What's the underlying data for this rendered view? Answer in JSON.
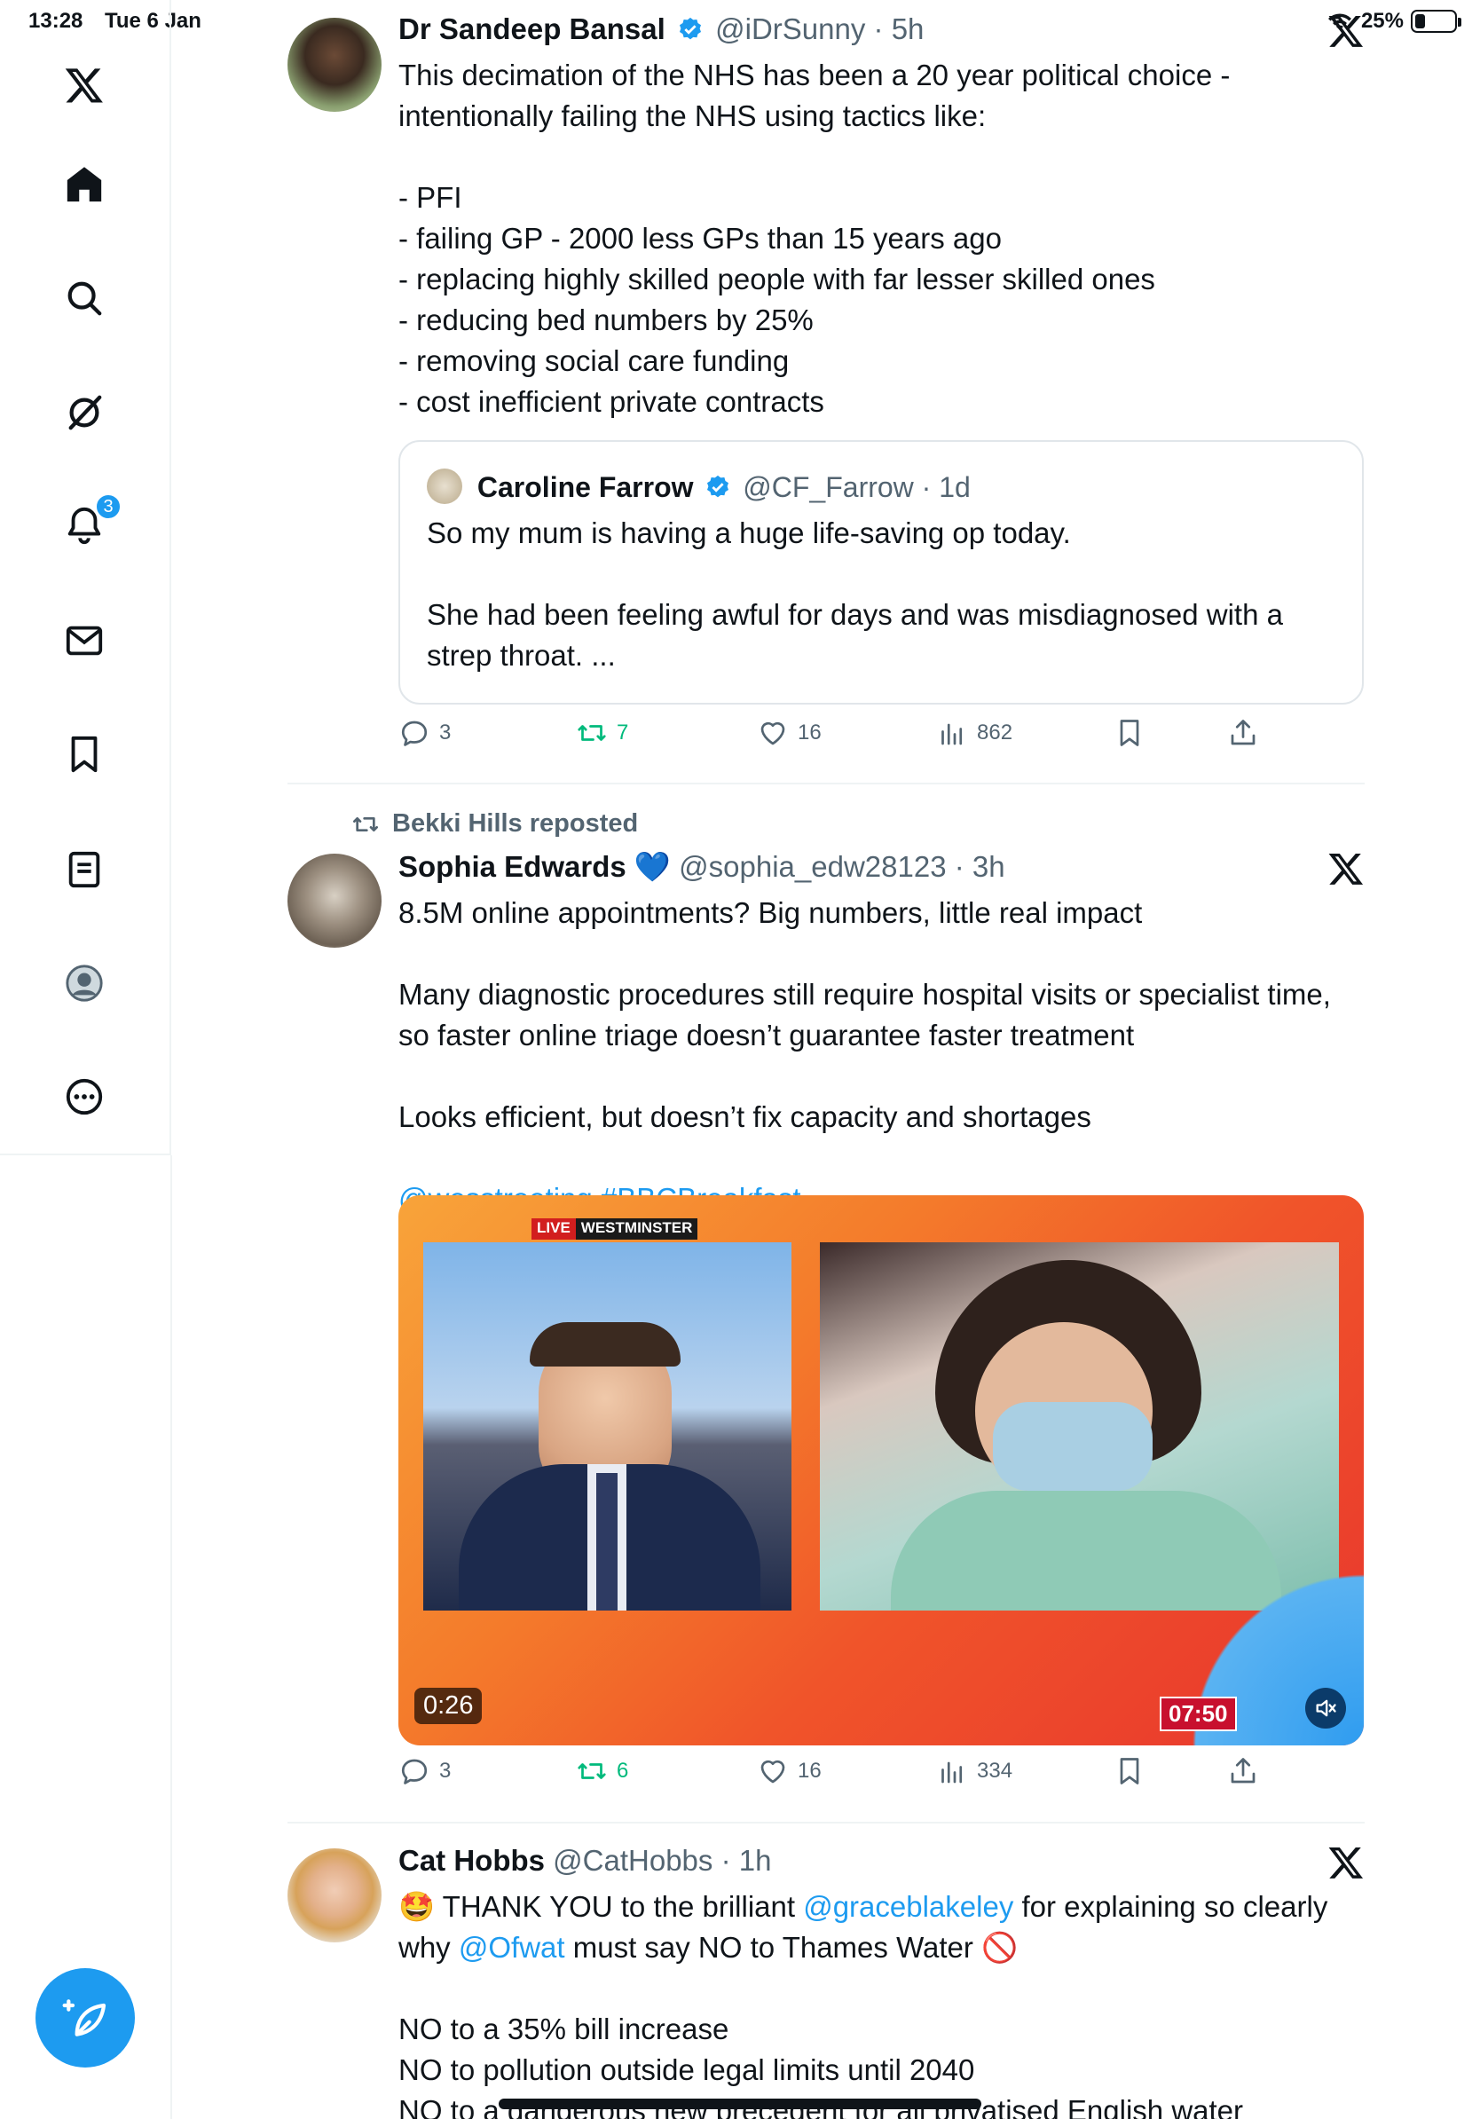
{
  "status_bar": {
    "time": "13:28",
    "date": "Tue 6 Jan",
    "battery": "25%"
  },
  "sidebar": {
    "items": [
      {
        "name": "x-logo",
        "label": "X"
      },
      {
        "name": "home",
        "label": "Home"
      },
      {
        "name": "explore",
        "label": "Explore"
      },
      {
        "name": "grok",
        "label": "Grok"
      },
      {
        "name": "notifications",
        "label": "Notifications",
        "badge": "3"
      },
      {
        "name": "messages",
        "label": "Messages"
      },
      {
        "name": "bookmarks",
        "label": "Bookmarks"
      },
      {
        "name": "lists",
        "label": "Lists"
      },
      {
        "name": "profile",
        "label": "Profile"
      },
      {
        "name": "more",
        "label": "More"
      }
    ],
    "notification_badge": "3"
  },
  "tweets": [
    {
      "author": "Dr Sandeep Bansal",
      "handle": "@iDrSunny",
      "time": "· 5h",
      "verified": true,
      "text": "This decimation of the NHS has been a 20 year political choice - intentionally failing the NHS using tactics like:\n\n- PFI\n- failing GP - 2000 less GPs than 15 years ago\n- replacing highly skilled people with far lesser skilled ones\n- reducing bed numbers by 25%\n- removing social care funding\n- cost inefficient private contracts",
      "quote": {
        "author": "Caroline Farrow",
        "handle": "@CF_Farrow",
        "time": "· 1d",
        "text": "So my mum is having a huge life-saving op today.\n\nShe had been feeling awful for days and was misdiagnosed with a strep throat. ..."
      },
      "stats": {
        "replies": "3",
        "reposts": "7",
        "likes": "16",
        "views": "862"
      }
    },
    {
      "repost_label": "Bekki Hills reposted",
      "author": "Sophia Edwards",
      "author_emoji": "💙",
      "handle": "@sophia_edw28123",
      "time": "· 3h",
      "text": "8.5M online appointments? Big numbers, little real impact\n\nMany diagnostic procedures still require hospital visits or specialist time, so faster online triage doesn’t guarantee faster treatment\n\nLooks efficient, but doesn’t fix capacity and shortages",
      "links": [
        "@wesstreeting",
        "#BBCBreakfast"
      ],
      "media": {
        "live": "LIVE",
        "location": "WESTMINSTER",
        "duration": "0:26",
        "clock": "07:50"
      },
      "stats": {
        "replies": "3",
        "reposts": "6",
        "likes": "16",
        "views": "334"
      }
    },
    {
      "author": "Cat Hobbs",
      "handle": "@CatHobbs",
      "time": "· 1h",
      "text_part1": "🤩 THANK YOU to the brilliant ",
      "mention1": "@graceblakeley",
      "text_part2": " for explaining so clearly why ",
      "mention2": "@Ofwat",
      "text_part3": " must say NO to Thames Water 🚫",
      "text_after": "NO to a 35% bill increase\nNO to pollution outside legal limits until 2040\nNO to a dangerous new precedent for all privatised English water"
    }
  ],
  "colors": {
    "accent": "#1d9bf0",
    "repost": "#00ba7c",
    "muted": "#536471",
    "text": "#0f1419"
  }
}
